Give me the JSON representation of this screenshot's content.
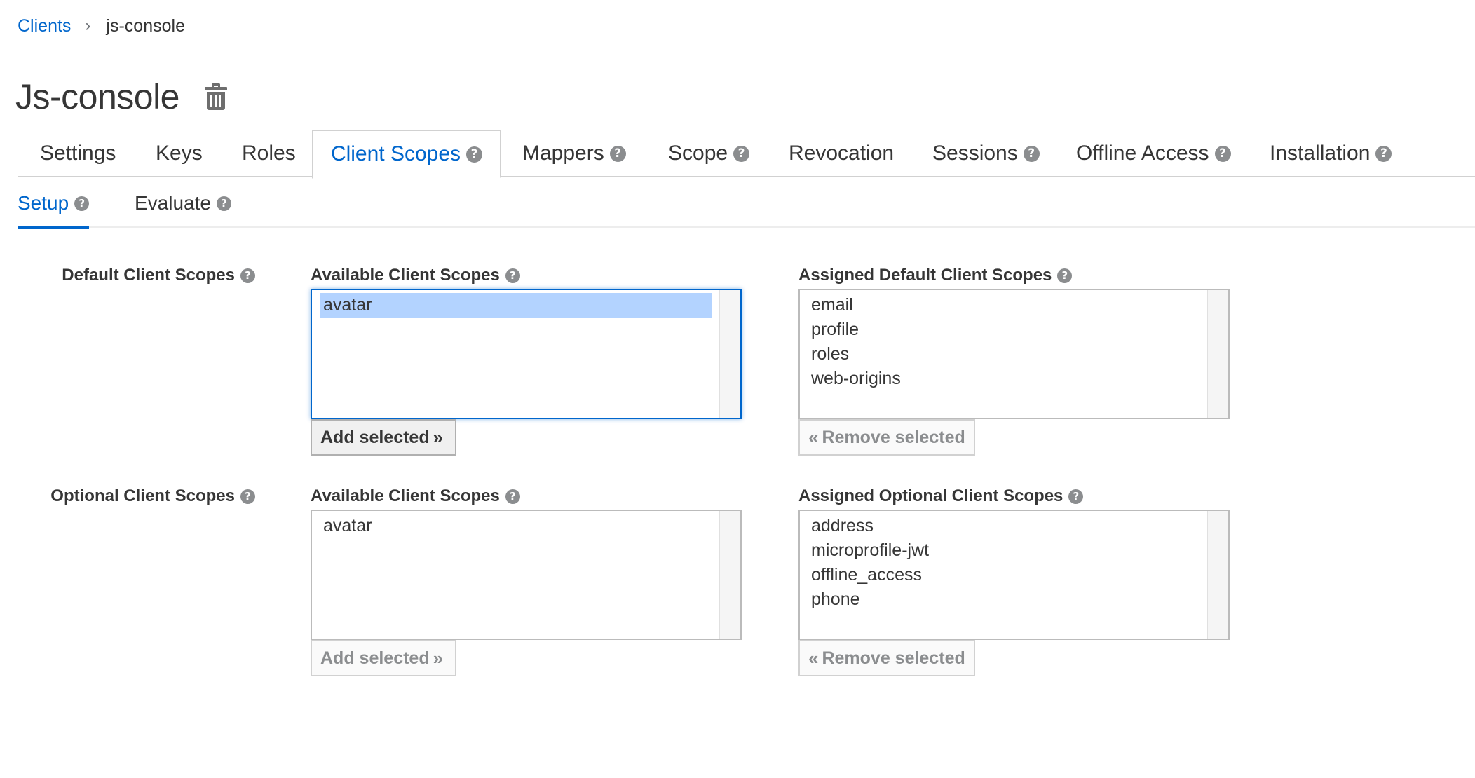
{
  "breadcrumb": {
    "parent": "Clients",
    "separator": "›",
    "current": "js-console"
  },
  "page": {
    "title": "Js-console"
  },
  "main_tabs": [
    {
      "label": "Settings",
      "help": false
    },
    {
      "label": "Keys",
      "help": false
    },
    {
      "label": "Roles",
      "help": false
    },
    {
      "label": "Client Scopes",
      "help": true,
      "active": true
    },
    {
      "label": "Mappers",
      "help": true
    },
    {
      "label": "Scope",
      "help": true
    },
    {
      "label": "Revocation",
      "help": false
    },
    {
      "label": "Sessions",
      "help": true
    },
    {
      "label": "Offline Access",
      "help": true
    },
    {
      "label": "Installation",
      "help": true
    }
  ],
  "sub_tabs": [
    {
      "label": "Setup",
      "help": true,
      "active": true
    },
    {
      "label": "Evaluate",
      "help": true
    }
  ],
  "help_glyph": "?",
  "default_scopes": {
    "label": "Default Client Scopes",
    "available_label": "Available Client Scopes",
    "available_items": [
      "avatar"
    ],
    "available_selected": "avatar",
    "assigned_label": "Assigned Default Client Scopes",
    "assigned_items": [
      "email",
      "profile",
      "roles",
      "web-origins"
    ],
    "add_button": "Add selected",
    "remove_button": "Remove selected"
  },
  "optional_scopes": {
    "label": "Optional Client Scopes",
    "available_label": "Available Client Scopes",
    "available_items": [
      "avatar"
    ],
    "assigned_label": "Assigned Optional Client Scopes",
    "assigned_items": [
      "address",
      "microprofile-jwt",
      "offline_access",
      "phone"
    ],
    "add_button": "Add selected",
    "remove_button": "Remove selected"
  },
  "icons": {
    "delete": "trash-icon",
    "help": "question-circle-icon",
    "double_right": "angle-double-right-icon",
    "double_left": "angle-double-left-icon"
  },
  "colors": {
    "link": "#0066cc",
    "selection": "#b3d3ff",
    "help_icon": "#8b8d8f",
    "text": "#363636"
  }
}
